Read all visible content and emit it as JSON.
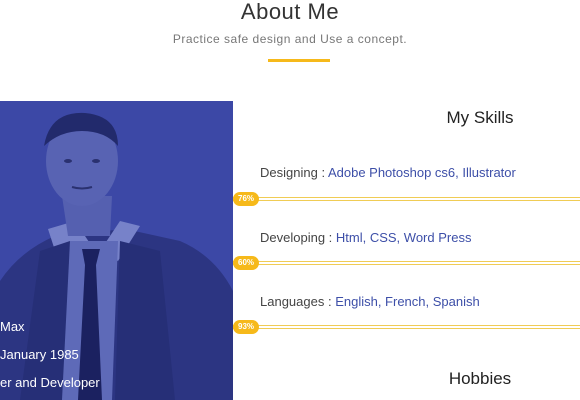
{
  "header": {
    "title": "About Me",
    "subtitle": "Practice safe design and Use a concept."
  },
  "profile": {
    "lines": [
      "Max",
      "January 1985",
      "er and Developer"
    ]
  },
  "skills_section": {
    "title": "My Skills",
    "items": [
      {
        "name": "Designing",
        "separator": " : ",
        "value": "Adobe Photoshop cs6, Illustrator",
        "percent_label": "76%",
        "percent": 76
      },
      {
        "name": "Developing",
        "separator": " : ",
        "value": "Html, CSS, Word Press",
        "percent_label": "60%",
        "percent": 60
      },
      {
        "name": "Languages",
        "separator": " : ",
        "value": "English, French, Spanish",
        "percent_label": "93%",
        "percent": 93
      }
    ]
  },
  "hobbies_section": {
    "title": "Hobbies"
  },
  "colors": {
    "accent": "#f6b91a",
    "panel_blue": "#3c48a6",
    "link_blue": "#3d4fa8"
  }
}
